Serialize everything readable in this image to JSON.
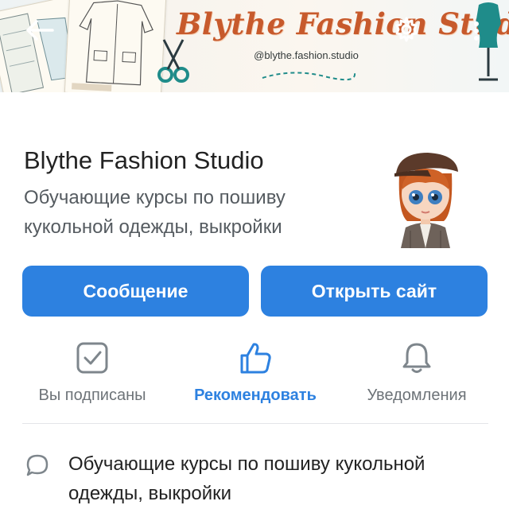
{
  "cover": {
    "title": "Blythe Fashion Studio",
    "handle": "@blythe.fashion.studio"
  },
  "toolbar": {
    "back_icon": "back-arrow-icon",
    "settings_icon": "gear-icon",
    "more_icon": "more-vertical-icon"
  },
  "profile": {
    "name": "Blythe Fashion Studio",
    "status": "Обучающие курсы по пошиву кукольной одежды, выкройки",
    "avatar_icon": "doll-avatar"
  },
  "actions": {
    "message_label": "Сообщение",
    "open_site_label": "Открыть сайт"
  },
  "quick_actions": [
    {
      "label": "Вы подписаны",
      "icon": "checkbox-checked-icon"
    },
    {
      "label": "Рекомендовать",
      "icon": "thumbs-up-icon"
    },
    {
      "label": "Уведомления",
      "icon": "bell-icon"
    }
  ],
  "info": {
    "icon": "speech-bubble-icon",
    "text": "Обучающие курсы по пошиву кукольной одежды, выкройки"
  },
  "colors": {
    "accent": "#2d81e0",
    "title_orange": "#c75a2c",
    "muted_text": "#6d7378",
    "text": "#222222"
  }
}
